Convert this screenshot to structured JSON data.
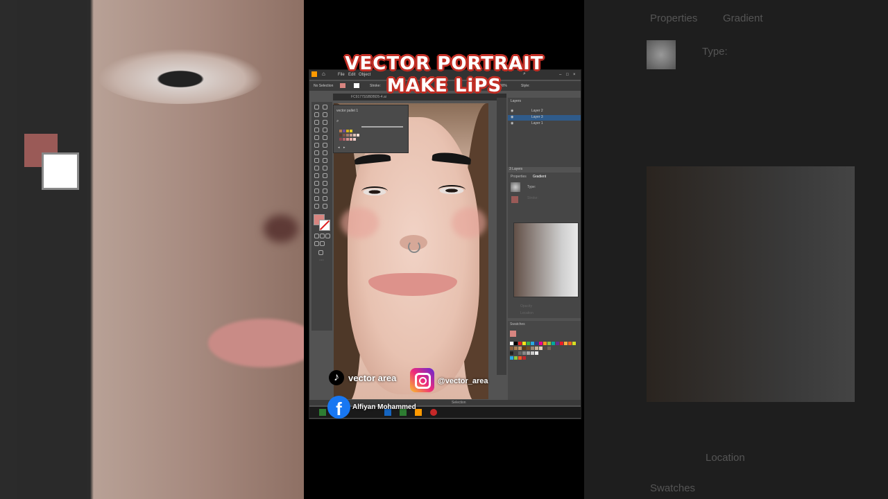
{
  "overlay": {
    "title_line1": "VECTOR PORTRAIT",
    "title_line2": "MAKE LiPS"
  },
  "social": {
    "tiktok_handle": "vector area",
    "instagram_handle": "@vector_area",
    "facebook_name": "Alfiyan Mohammed"
  },
  "app": {
    "menu": [
      "File",
      "Edit",
      "Object"
    ],
    "control_bar": {
      "selection_label": "No Selection",
      "stroke_label": "Stroke:",
      "opacity_value": "100%",
      "style_label": "Style:"
    },
    "document_tab": "FC9177SSBDBD5-4.ai",
    "swatch_panel_title": "vector pallet 1",
    "layers": {
      "tab": "Layers",
      "items": [
        "Layer 2",
        "Layer 3",
        "Layer 1"
      ],
      "count_label": "3 Layers"
    },
    "properties": {
      "tabs": [
        "Properties",
        "Gradient"
      ],
      "type_label": "Type:",
      "stroke_label": "Stroke:",
      "opacity_label": "Opacity",
      "location_label": "Location"
    },
    "swatches_tab": "Swatches",
    "status_label": "Selection"
  },
  "backdrop_right": {
    "tabs": [
      "Properties",
      "Gradient"
    ],
    "type_label": "Type:",
    "location_label": "Location",
    "swatches_label": "Swatches"
  },
  "colors": {
    "fill": "#d88580",
    "lips": "#dd928b",
    "title_outline": "#c02e25"
  }
}
